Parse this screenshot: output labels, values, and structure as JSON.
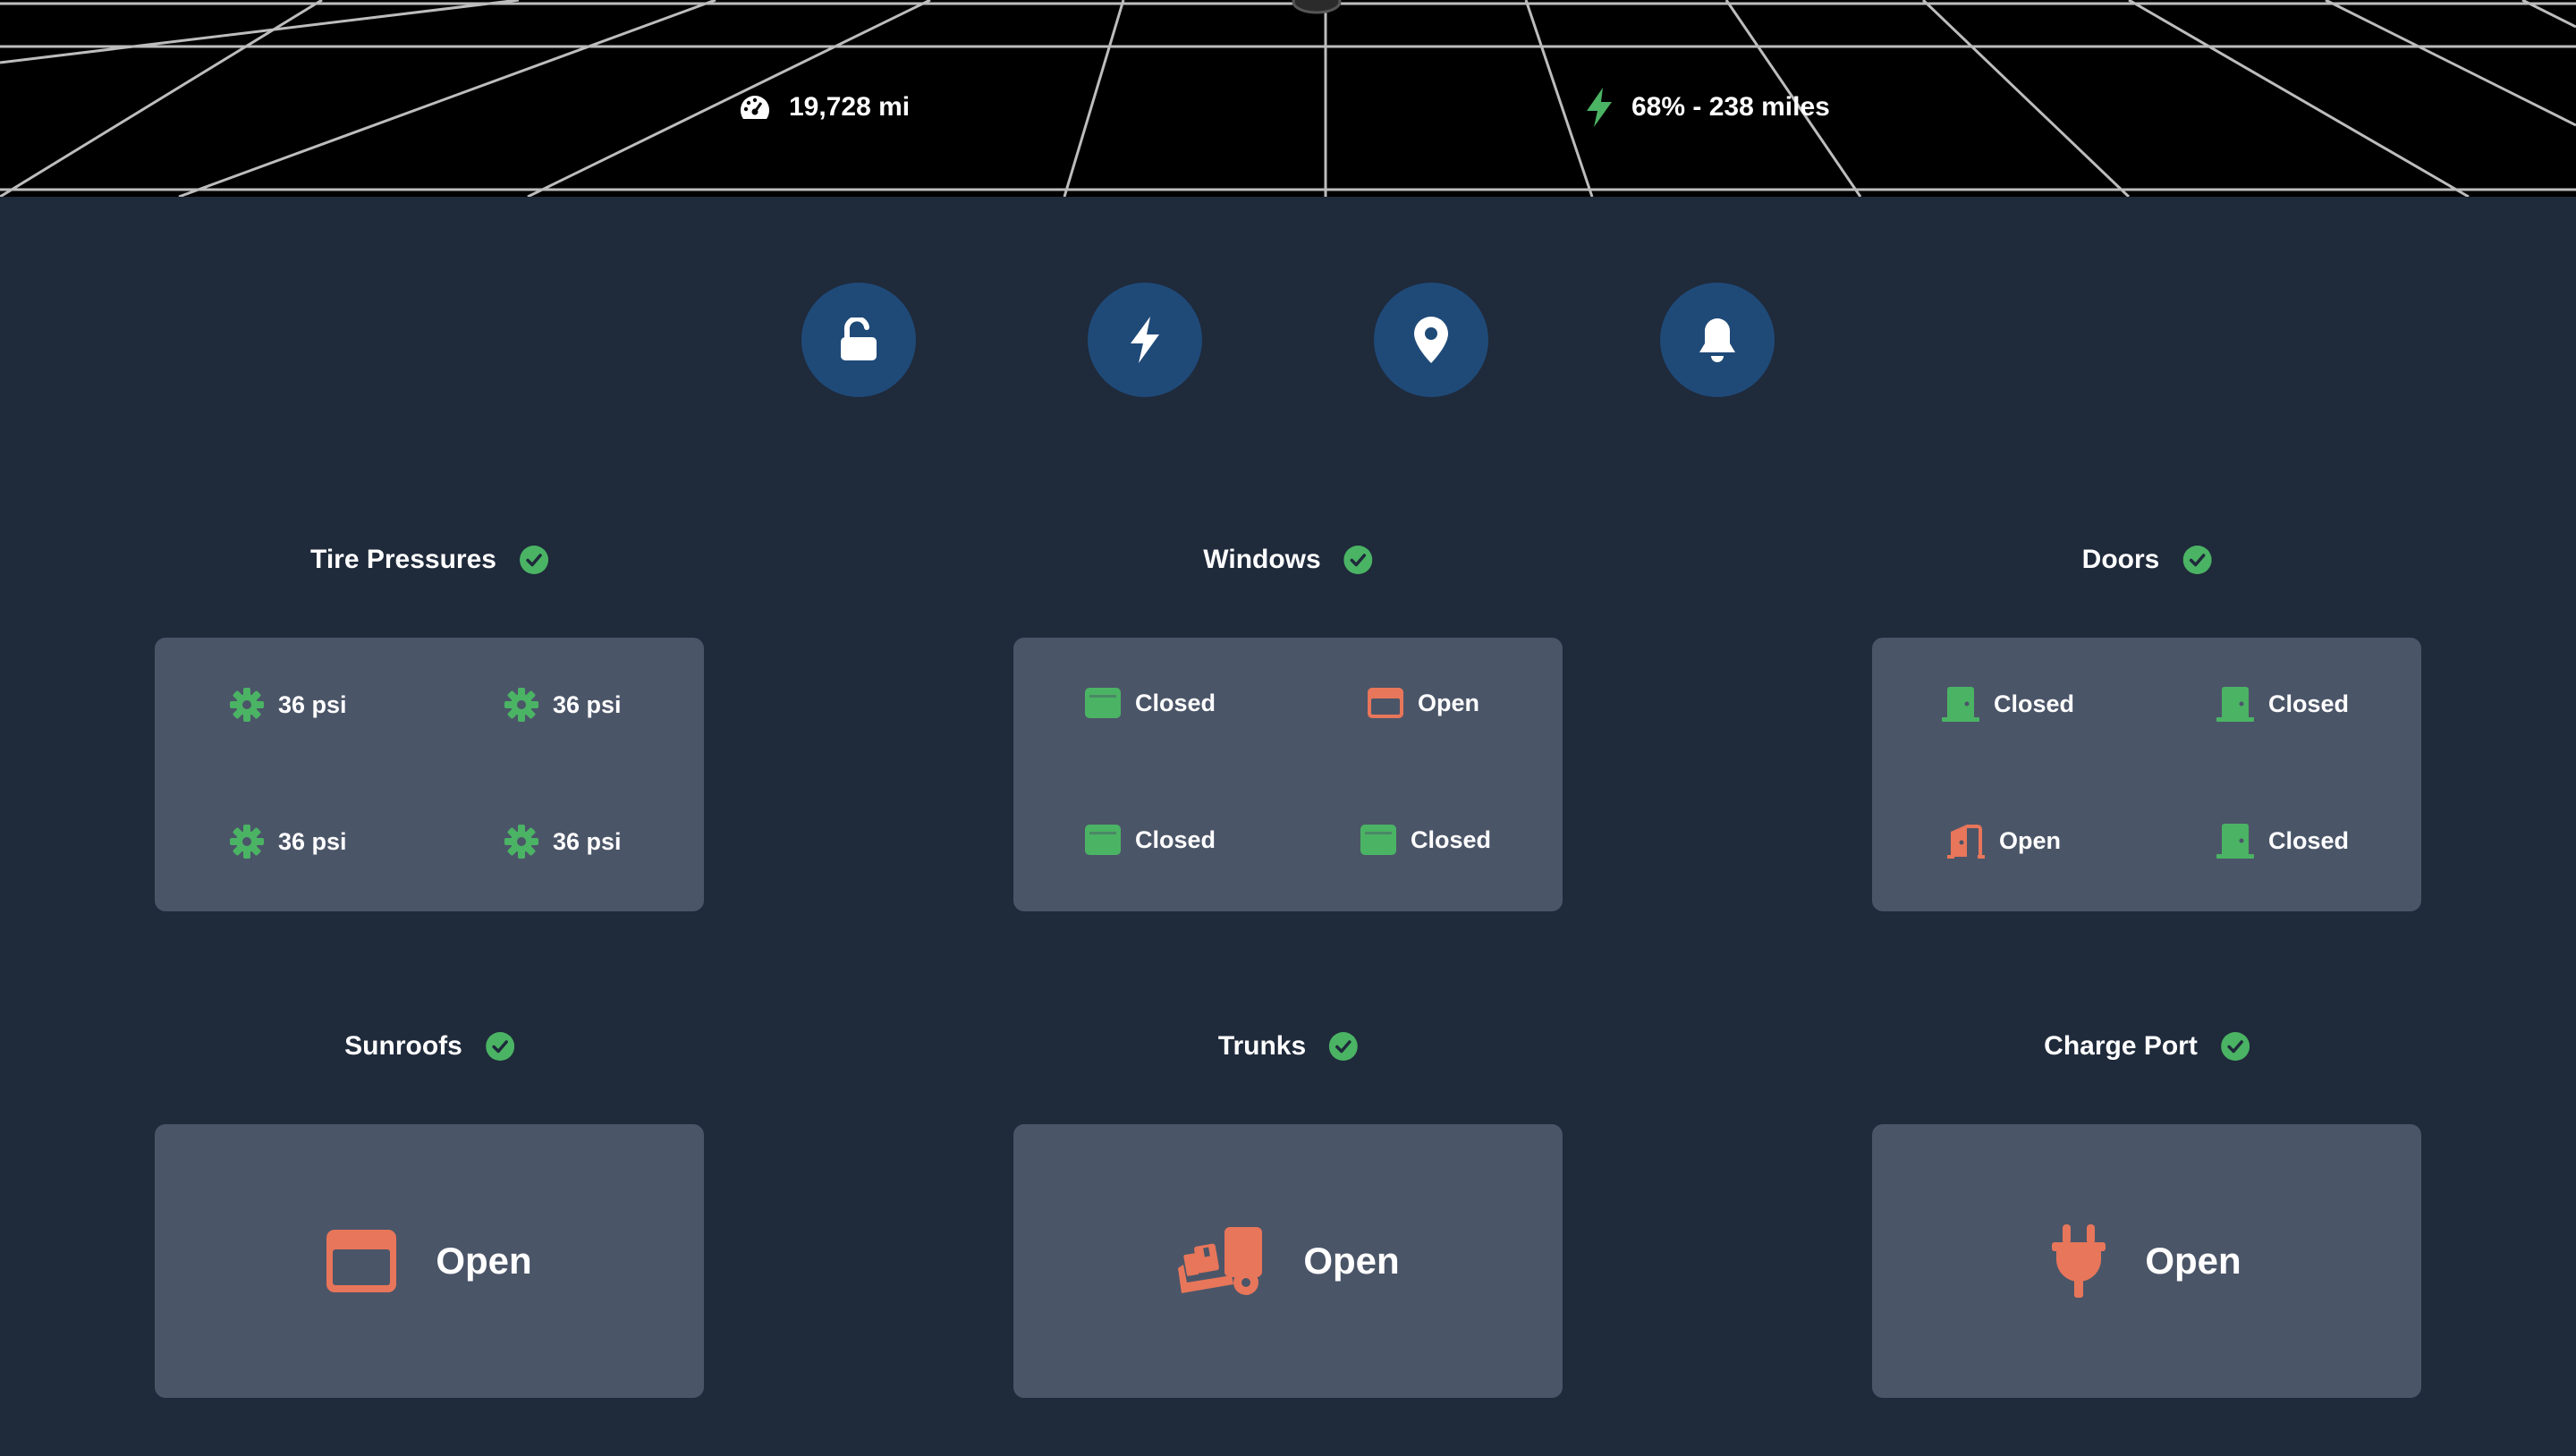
{
  "header": {
    "odometer": {
      "icon": "speedometer-icon",
      "value": "19,728 mi"
    },
    "battery": {
      "icon": "lightning-icon",
      "value": "68% - 238 miles"
    }
  },
  "actions": [
    {
      "icon": "unlock-icon"
    },
    {
      "icon": "lightning-icon"
    },
    {
      "icon": "location-pin-icon"
    },
    {
      "icon": "bell-icon"
    }
  ],
  "colors": {
    "ok": "#4bb364",
    "warn": "#e8765a",
    "card": "#4b5568",
    "background": "#1f2a3b",
    "action": "#1f4a78"
  },
  "sections": {
    "tires": {
      "title": "Tire Pressures",
      "status": "ok",
      "items": [
        {
          "label": "36 psi",
          "icon": "gear-icon",
          "state": "ok"
        },
        {
          "label": "36 psi",
          "icon": "gear-icon",
          "state": "ok"
        },
        {
          "label": "36 psi",
          "icon": "gear-icon",
          "state": "ok"
        },
        {
          "label": "36 psi",
          "icon": "gear-icon",
          "state": "ok"
        }
      ]
    },
    "windows": {
      "title": "Windows",
      "status": "ok",
      "items": [
        {
          "label": "Closed",
          "icon": "window-closed-icon",
          "state": "ok"
        },
        {
          "label": "Open",
          "icon": "window-open-icon",
          "state": "warn"
        },
        {
          "label": "Closed",
          "icon": "window-closed-icon",
          "state": "ok"
        },
        {
          "label": "Closed",
          "icon": "window-closed-icon",
          "state": "ok"
        }
      ]
    },
    "doors": {
      "title": "Doors",
      "status": "ok",
      "items": [
        {
          "label": "Closed",
          "icon": "door-closed-icon",
          "state": "ok"
        },
        {
          "label": "Closed",
          "icon": "door-closed-icon",
          "state": "ok"
        },
        {
          "label": "Open",
          "icon": "door-open-icon",
          "state": "warn"
        },
        {
          "label": "Closed",
          "icon": "door-closed-icon",
          "state": "ok"
        }
      ]
    },
    "sunroofs": {
      "title": "Sunroofs",
      "status": "ok",
      "label": "Open",
      "icon": "window-open-icon",
      "state": "warn"
    },
    "trunks": {
      "title": "Trunks",
      "status": "ok",
      "label": "Open",
      "icon": "dolly-icon",
      "state": "warn"
    },
    "charge_port": {
      "title": "Charge Port",
      "status": "ok",
      "label": "Open",
      "icon": "plug-icon",
      "state": "warn"
    }
  }
}
